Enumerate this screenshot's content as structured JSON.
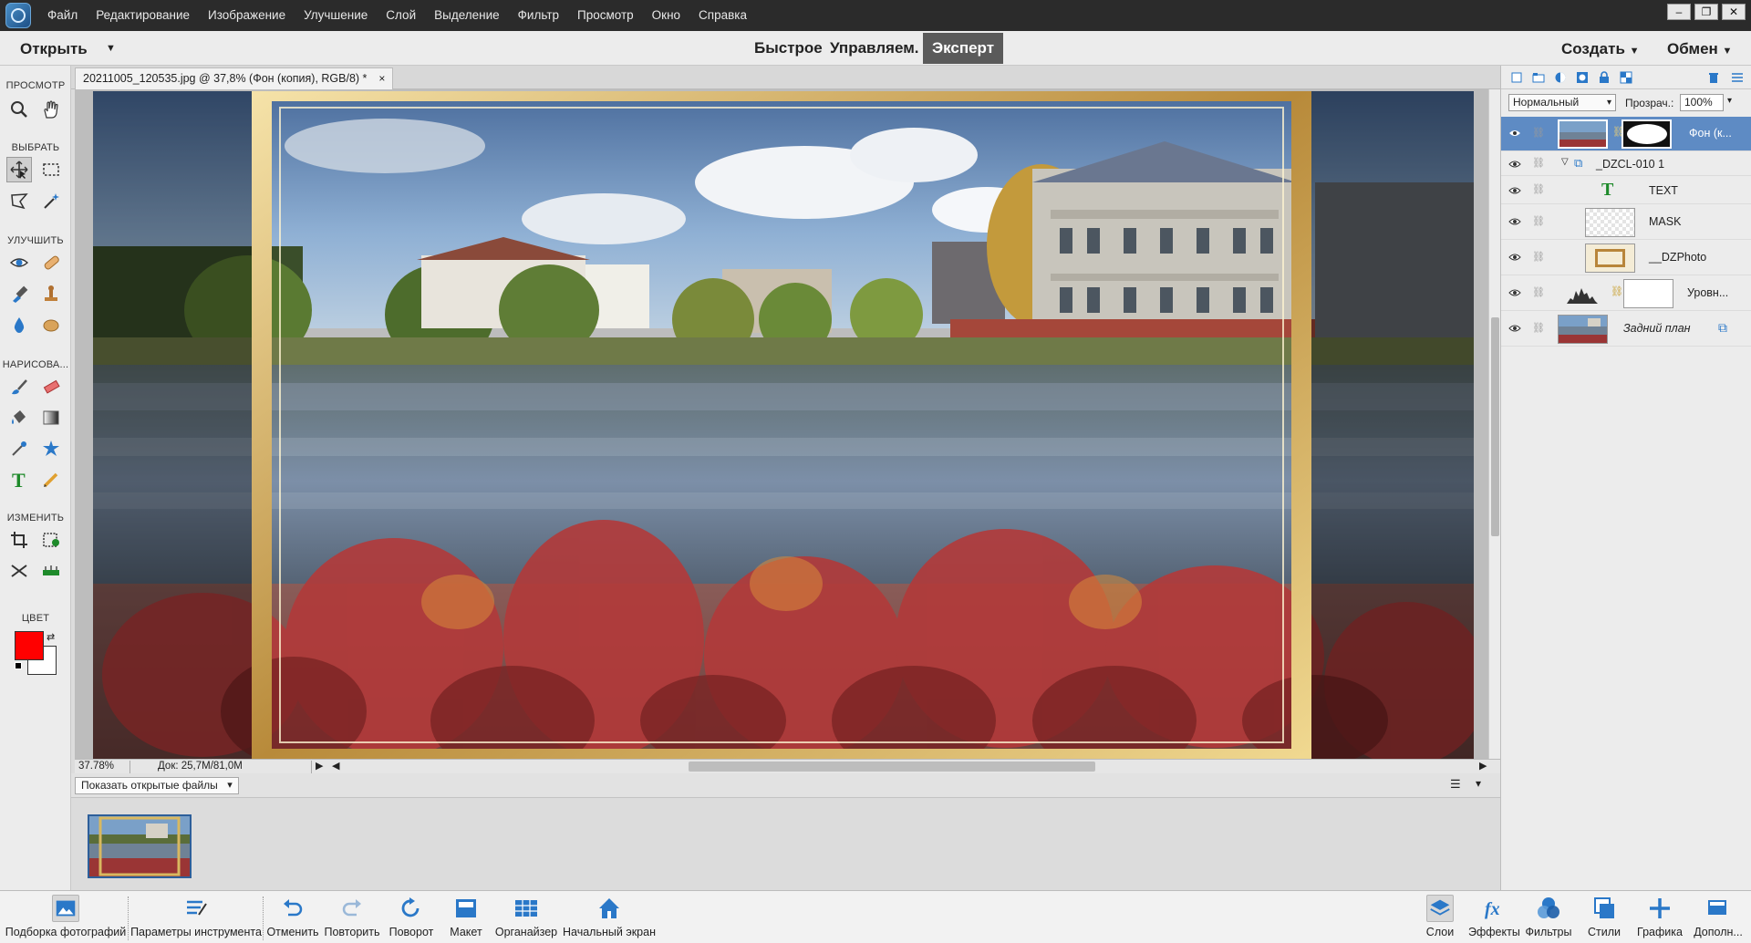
{
  "menubar": {
    "items": [
      "Файл",
      "Редактирование",
      "Изображение",
      "Улучшение",
      "Слой",
      "Выделение",
      "Фильтр",
      "Просмотр",
      "Окно",
      "Справка"
    ]
  },
  "modebar": {
    "open_label": "Открыть",
    "modes": [
      "Быстрое",
      "Управляем.",
      "Эксперт"
    ],
    "active_mode": "Эксперт",
    "create_label": "Создать",
    "share_label": "Обмен"
  },
  "toolbar": {
    "sections": {
      "view": "ПРОСМОТР",
      "select": "ВЫБРАТЬ",
      "enhance": "УЛУЧШИТЬ",
      "draw": "НАРИСОВА...",
      "modify": "ИЗМЕНИТЬ",
      "color": "ЦВЕТ"
    },
    "foreground_color": "#ff0000",
    "background_color": "#ffffff"
  },
  "document": {
    "tab_title": "20211005_120535.jpg @ 37,8% (Фон (копия), RGB/8) *",
    "tab_close": "×"
  },
  "status": {
    "zoom": "37.78%",
    "doc_size": "Док: 25,7M/81,0M"
  },
  "photobin": {
    "show_files_label": "Показать открытые файлы"
  },
  "layers": {
    "blend_mode": "Нормальный",
    "opacity_label": "Прозрач.:",
    "opacity_value": "100%",
    "items": [
      {
        "name": "Фон (к...",
        "active": true
      },
      {
        "name": "_DZCL-010 1"
      },
      {
        "name": "TEXT"
      },
      {
        "name": "MASK"
      },
      {
        "name": "__DZPhoto"
      },
      {
        "name": "Уровн..."
      },
      {
        "name": "Задний план"
      }
    ]
  },
  "bottombar": {
    "left": [
      {
        "label": "Подборка фотографий",
        "icon": "photo-bin-icon"
      },
      {
        "label": "Параметры инструмента",
        "icon": "tool-options-icon"
      },
      {
        "label": "Отменить",
        "icon": "undo-icon"
      },
      {
        "label": "Повторить",
        "icon": "redo-icon"
      },
      {
        "label": "Поворот",
        "icon": "rotate-icon"
      },
      {
        "label": "Макет",
        "icon": "layout-icon"
      },
      {
        "label": "Органайзер",
        "icon": "organizer-icon"
      },
      {
        "label": "Начальный экран",
        "icon": "home-icon"
      }
    ],
    "right": [
      {
        "label": "Слои",
        "icon": "layers-icon"
      },
      {
        "label": "Эффекты",
        "icon": "effects-icon"
      },
      {
        "label": "Фильтры",
        "icon": "filters-icon"
      },
      {
        "label": "Стили",
        "icon": "styles-icon"
      },
      {
        "label": "Графика",
        "icon": "graphics-icon"
      },
      {
        "label": "Дополн...",
        "icon": "more-icon"
      }
    ]
  },
  "colors": {
    "accent": "#5e8bc4",
    "menubar_bg": "#2b2b2b",
    "icon_blue": "#2a78c8"
  }
}
